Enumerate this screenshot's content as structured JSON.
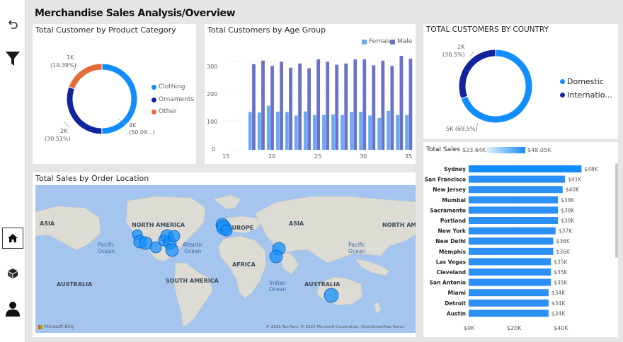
{
  "page": {
    "title": "Merchandise Sales Analysis/Overview"
  },
  "sidebar": {
    "items": [
      {
        "icon": "undo-icon"
      },
      {
        "icon": "filter-icon"
      },
      {
        "icon": "home-icon",
        "active": true
      },
      {
        "icon": "box-icon"
      },
      {
        "icon": "user-icon"
      }
    ]
  },
  "colors": {
    "clothing": "#118dff",
    "ornaments": "#12239e",
    "other": "#e66c37",
    "female": "#6aaaf5",
    "male": "#6b72c9",
    "domestic": "#118dff",
    "international": "#12239e",
    "bar": "#2b8ff5"
  },
  "category_card": {
    "title": "Total Customer by Product Category",
    "slice_labels": [
      {
        "value": "1K",
        "pct": "(19.39%)"
      },
      {
        "value": "4K",
        "pct": "(50.09...)"
      },
      {
        "value": "2K",
        "pct": "(30.51%)"
      }
    ],
    "legend": [
      "Clothing",
      "Ornaments",
      "Other"
    ]
  },
  "age_card": {
    "title": "Total Customers by Age Group",
    "legend": [
      "Female",
      "Male"
    ],
    "y_ticks": [
      "300",
      "200",
      "100",
      "0"
    ],
    "x_ticks": [
      "15",
      "20",
      "25",
      "30",
      "35"
    ]
  },
  "country_card": {
    "title": "TOTAL CUSTOMERS BY COUNTRY",
    "label_top": {
      "value": "2K",
      "pct": "(30.5%)"
    },
    "label_bottom": "5K (69.5%)",
    "legend": [
      "Domestic",
      "Internatio..."
    ]
  },
  "sales_card": {
    "title": "Total Sales",
    "scale_min": "$23.64K",
    "scale_max": "$48.05K",
    "x_ticks": [
      "$0K",
      "$20K",
      "$40K"
    ]
  },
  "map_card": {
    "title": "Total Sales by Order Location",
    "continents": [
      "ASIA",
      "NORTH AMERICA",
      "EUROPE",
      "ASIA",
      "NORTH AME",
      "AFRICA",
      "AUSTRALIA",
      "SOUTH AMERICA",
      "AUSTRALIA"
    ],
    "oceans": [
      "Pacific\nOcean",
      "Atlantic\nOcean",
      "Pacific\nOcean",
      "Indian\nOcean"
    ],
    "logo": "Microsoft Bing",
    "attribution": "© 2025 TomTom, © 2025 Microsoft Corporation, OpenStreetMap  Terms"
  },
  "chart_data": [
    {
      "type": "pie",
      "title": "Total Customer by Product Category",
      "categories": [
        "Clothing",
        "Ornaments",
        "Other"
      ],
      "values": [
        50.09,
        30.51,
        19.39
      ],
      "value_labels": [
        "4K",
        "2K",
        "1K"
      ]
    },
    {
      "type": "bar",
      "title": "Total Customers by Age Group",
      "x": [
        18,
        19,
        20,
        21,
        22,
        23,
        24,
        25,
        26,
        27,
        28,
        29,
        30,
        31,
        32,
        33,
        34,
        35
      ],
      "series": [
        {
          "name": "Female",
          "values": [
            128,
            126,
            149,
            129,
            128,
            116,
            130,
            118,
            118,
            120,
            118,
            128,
            128,
            116,
            108,
            132,
            118,
            118
          ]
        },
        {
          "name": "Male",
          "values": [
            290,
            302,
            284,
            298,
            278,
            292,
            276,
            306,
            298,
            288,
            292,
            306,
            306,
            286,
            302,
            284,
            318,
            308
          ]
        }
      ],
      "ylim": [
        0,
        330
      ],
      "xlim": [
        15,
        35.5
      ]
    },
    {
      "type": "pie",
      "title": "TOTAL CUSTOMERS BY COUNTRY",
      "categories": [
        "Domestic",
        "Internatio..."
      ],
      "values": [
        69.5,
        30.5
      ],
      "value_labels": [
        "5K",
        "2K"
      ]
    },
    {
      "type": "bar",
      "title": "Total Sales",
      "categories": [
        "Sydney",
        "San Francisco",
        "New Jersey",
        "Mumbai",
        "Sacramento",
        "Portland",
        "New York",
        "New Delhi",
        "Memphis",
        "Las Vegas",
        "Cleveland",
        "San Antonio",
        "Miami",
        "Detroit",
        "Austin"
      ],
      "values": [
        48,
        41,
        40,
        38,
        38,
        38,
        37,
        36,
        36,
        35,
        35,
        35,
        34,
        34,
        34
      ],
      "value_labels": [
        "$48K",
        "$41K",
        "$40K",
        "$38K",
        "$38K",
        "$38K",
        "$37K",
        "$36K",
        "$36K",
        "$35K",
        "$35K",
        "$35K",
        "$34K",
        "$34K",
        "$34K"
      ],
      "xlim": [
        0,
        55
      ]
    }
  ]
}
